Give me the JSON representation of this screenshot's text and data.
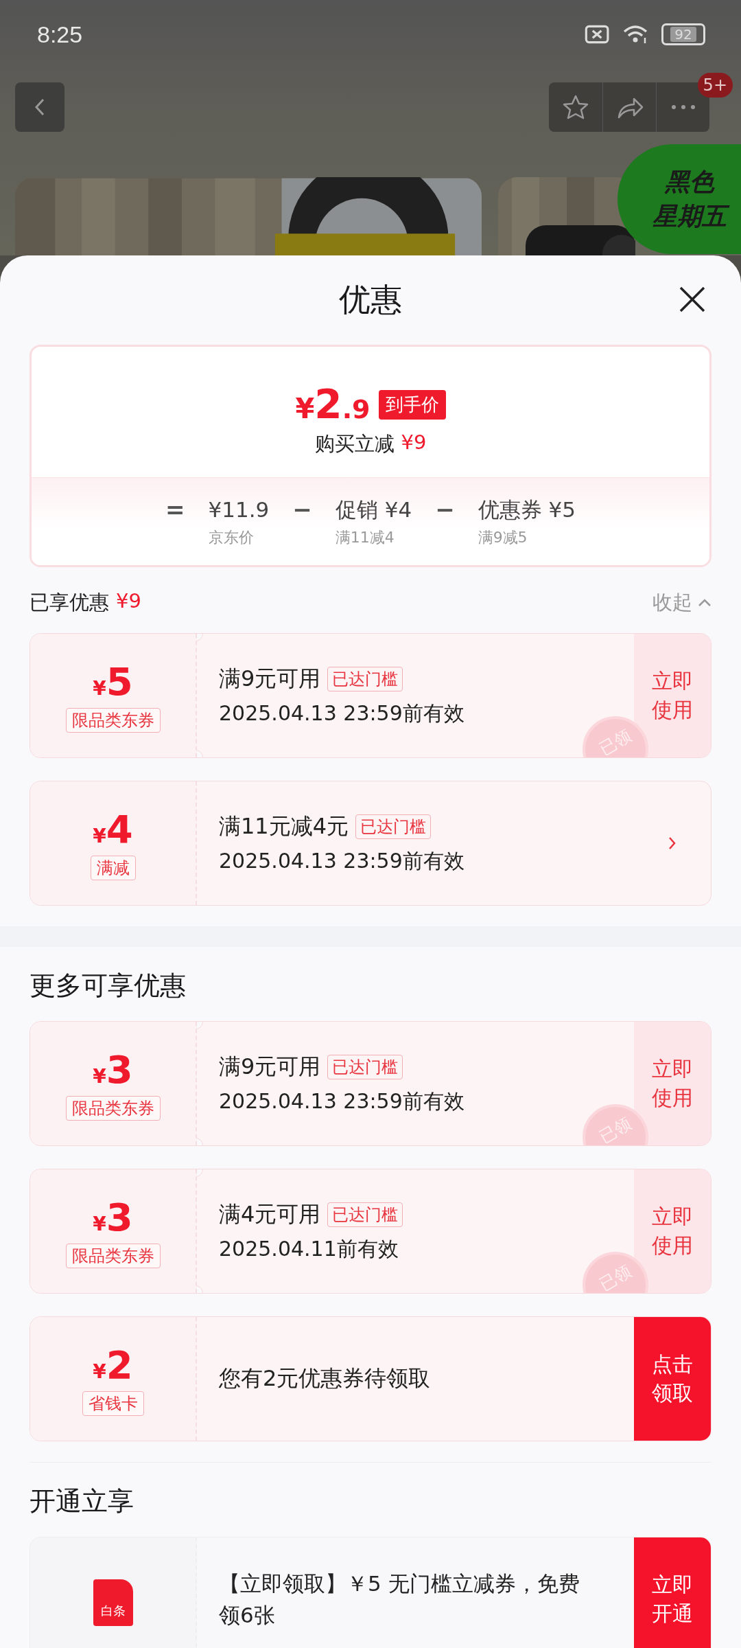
{
  "status_bar": {
    "time": "8:25",
    "battery": "92"
  },
  "nav": {
    "badge": "5+"
  },
  "promo_badge": {
    "lines": [
      "黑色",
      "星期五"
    ]
  },
  "sheet": {
    "title": "优惠"
  },
  "price_summary": {
    "currency": "¥",
    "price_whole": "2",
    "price_fraction": ".9",
    "tag": "到手价",
    "saving_label": "购买立减",
    "saving": "¥9",
    "formula": [
      {
        "kind": "operator",
        "text": "="
      },
      {
        "kind": "term",
        "value": "¥11.9",
        "note": "京东价"
      },
      {
        "kind": "operator",
        "text": "−"
      },
      {
        "kind": "term",
        "value": "促销 ¥4",
        "note": "满11减4"
      },
      {
        "kind": "operator",
        "text": "−"
      },
      {
        "kind": "term",
        "value": "优惠券 ¥5",
        "note": "满9减5"
      }
    ]
  },
  "applied": {
    "label": "已享优惠",
    "amount": "¥9",
    "toggle": "收起",
    "expanded": true
  },
  "applied_coupons": [
    {
      "kind": "coupon",
      "notched": true,
      "currency": "¥",
      "amount": "5",
      "type_label": "限品类东券",
      "condition": "满9元可用",
      "badge": "已达门槛",
      "validity": "2025.04.13 23:59前有效",
      "action": {
        "kind": "soft",
        "text": "立即使用"
      },
      "stamp": "已领"
    },
    {
      "kind": "coupon",
      "notched": false,
      "currency": "¥",
      "amount": "4",
      "type_label": "满减",
      "condition": "满11元减4元",
      "badge": "已达门槛",
      "validity": "2025.04.13 23:59前有效",
      "action": {
        "kind": "chevron"
      }
    }
  ],
  "sections": [
    {
      "title": "更多可享优惠",
      "coupons": [
        {
          "kind": "coupon",
          "notched": true,
          "currency": "¥",
          "amount": "3",
          "type_label": "限品类东券",
          "condition": "满9元可用",
          "badge": "已达门槛",
          "validity": "2025.04.13 23:59前有效",
          "action": {
            "kind": "soft",
            "text": "立即使用"
          },
          "stamp": "已领"
        },
        {
          "kind": "coupon",
          "notched": true,
          "currency": "¥",
          "amount": "3",
          "type_label": "限品类东券",
          "condition": "满4元可用",
          "badge": "已达门槛",
          "validity": "2025.04.11前有效",
          "action": {
            "kind": "soft",
            "text": "立即使用"
          },
          "stamp": "已领"
        },
        {
          "kind": "coupon",
          "notched": false,
          "currency": "¥",
          "amount": "2",
          "type_label": "省钱卡",
          "condition": "您有2元优惠券待领取",
          "action": {
            "kind": "solid",
            "text": "点击领取"
          }
        }
      ]
    },
    {
      "title": "开通立享",
      "coupons": [
        {
          "kind": "service",
          "notched": false,
          "icon_text": "白条",
          "condition": "【立即领取】￥5 无门槛立减券，免费领6张",
          "action": {
            "kind": "solid",
            "text": "立即开通"
          }
        }
      ]
    }
  ]
}
